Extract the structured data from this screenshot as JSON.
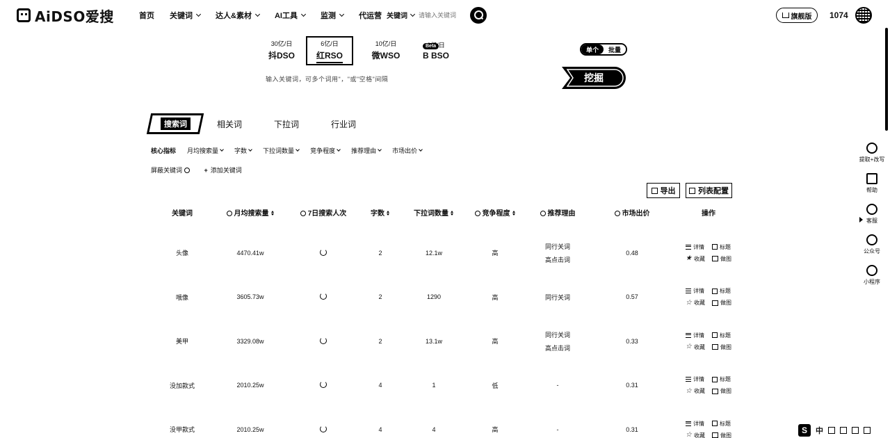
{
  "brand": {
    "name": "AiDSO爱搜"
  },
  "nav": {
    "items": [
      {
        "label": "首页",
        "dropdown": false
      },
      {
        "label": "关键词",
        "dropdown": true
      },
      {
        "label": "达人&素材",
        "dropdown": true
      },
      {
        "label": "AI工具",
        "dropdown": true
      },
      {
        "label": "监测",
        "dropdown": true
      },
      {
        "label": "代运营",
        "dropdown": false
      }
    ],
    "search": {
      "scope": "关键词",
      "placeholder": "请输入关键词"
    },
    "edition": "旗舰版",
    "points": "1074"
  },
  "engines": [
    {
      "volume": "30亿/日",
      "name": "抖DSO",
      "active": false
    },
    {
      "volume": "6亿/日",
      "name": "红RSO",
      "active": true
    },
    {
      "volume": "10亿/日",
      "name": "微WSO",
      "active": false
    },
    {
      "volume": "2亿/日",
      "name": "B BSO",
      "active": false
    }
  ],
  "beta_badge": "Beta",
  "search_placeholder": "输入关键词，可多个词用\"，\"或\"空格\"间隔",
  "mode": {
    "single": "单个",
    "batch": "批量"
  },
  "dig_button": "挖掘",
  "tabs": [
    "搜索词",
    "相关词",
    "下拉词",
    "行业词"
  ],
  "filters": {
    "label": "核心指标",
    "items": [
      "月均搜索量",
      "字数",
      "下拉词数量",
      "竞争程度",
      "推荐理由",
      "市场出价"
    ],
    "row2_label": "屏蔽关键词",
    "add_label": "添加关键词"
  },
  "actions": {
    "export": "导出",
    "config": "列表配置"
  },
  "table": {
    "headers": [
      "关键词",
      "月均搜索量",
      "7日搜索人次",
      "字数",
      "下拉词数量",
      "竞争程度",
      "推荐理由",
      "市场出价",
      "操作"
    ],
    "rows": [
      {
        "keyword": "头像",
        "monthly": "4470.41w",
        "digits": "2",
        "dropdown": "12.1w",
        "competition": "高",
        "reasons": [
          "同行关词",
          "高点击词"
        ],
        "bid": "0.48"
      },
      {
        "keyword": "哦像",
        "monthly": "3605.73w",
        "digits": "2",
        "dropdown": "1290",
        "competition": "高",
        "reasons": [
          "同行关词"
        ],
        "bid": "0.57"
      },
      {
        "keyword": "美甲",
        "monthly": "3329.08w",
        "digits": "2",
        "dropdown": "13.1w",
        "competition": "高",
        "reasons": [
          "同行关词",
          "高点击词"
        ],
        "bid": "0.33"
      },
      {
        "keyword": "没加款式",
        "monthly": "2010.25w",
        "digits": "4",
        "dropdown": "1",
        "competition": "低",
        "reasons": [
          "-"
        ],
        "bid": "0.31"
      },
      {
        "keyword": "没甲款式",
        "monthly": "2010.25w",
        "digits": "4",
        "dropdown": "4",
        "competition": "高",
        "reasons": [
          "-"
        ],
        "bid": "0.31"
      }
    ],
    "ops": {
      "detail": "详情",
      "tag": "标题",
      "fav": "收藏",
      "image": "做图"
    }
  },
  "rail": [
    {
      "label": "提取+改写",
      "icon": "ai-icon"
    },
    {
      "label": "帮助",
      "icon": "book-icon"
    },
    {
      "label": "客服",
      "icon": "headset-icon"
    },
    {
      "label": "公众号",
      "icon": "wechat-icon"
    },
    {
      "label": "小程序",
      "icon": "miniprogram-icon"
    }
  ],
  "ime": {
    "lang": "中"
  }
}
